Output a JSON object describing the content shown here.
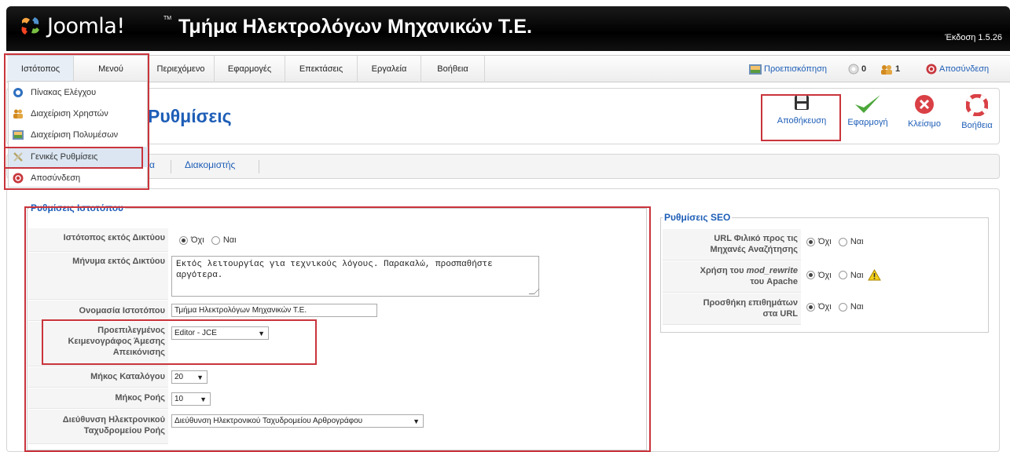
{
  "header": {
    "logo_text": "Joomla!",
    "logo_tm": "TM",
    "site_title": "Τμήμα Ηλεκτρολόγων Μηχανικών Τ.Ε.",
    "version": "Έκδοση 1.5.26"
  },
  "menubar": {
    "items": [
      {
        "label": "Ιστότοπος"
      },
      {
        "label": "Μενού"
      },
      {
        "label": "Περιεχόμενο"
      },
      {
        "label": "Εφαρμογές"
      },
      {
        "label": "Επεκτάσεις"
      },
      {
        "label": "Εργαλεία"
      },
      {
        "label": "Βοήθεια"
      }
    ],
    "preview": "Προεπισκόπηση",
    "messages_count": "0",
    "users_count": "1",
    "logout": "Αποσύνδεση"
  },
  "dropdown": {
    "items": [
      {
        "label": "Πίνακας Ελέγχου"
      },
      {
        "label": "Διαχείριση Χρηστών"
      },
      {
        "label": "Διαχείριση Πολυμέσων"
      },
      {
        "label": "Γενικές Ρυθμίσεις"
      },
      {
        "label": "Αποσύνδεση"
      }
    ]
  },
  "page": {
    "title": "Ρυθμίσεις"
  },
  "toolbar": {
    "save": "Αποθήκευση",
    "apply": "Εφαρμογή",
    "close": "Κλείσιμο",
    "help": "Βοήθεια"
  },
  "subtabs": {
    "partial": "α",
    "server": "Διακομιστής"
  },
  "site_settings": {
    "legend": "Ρυθμίσεις Ιστοτόπου",
    "offline_label": "Ιστότοπος εκτός Δικτύου",
    "no": "Όχι",
    "yes": "Ναι",
    "offline_msg_label": "Μήνυμα εκτός Δικτύου",
    "offline_msg_value": "Εκτός λειτουργίας για τεχνικούς λόγους. Παρακαλώ, προσπαθήστε αργότερα.",
    "site_name_label": "Ονομασία Ιστοτόπου",
    "site_name_value": "Τμήμα Ηλεκτρολόγων Μηχανικών Τ.Ε.",
    "editor_label_1": "Προεπιλεγμένος",
    "editor_label_2": "Κειμενογράφος Άμεσης",
    "editor_label_3": "Απεικόνισης",
    "editor_value": "Editor - JCE",
    "list_length_label": "Μήκος Καταλόγου",
    "list_length_value": "20",
    "feed_length_label": "Μήκος Ροής",
    "feed_length_value": "10",
    "feed_email_label_1": "Διεύθυνση Ηλεκτρονικού",
    "feed_email_label_2": "Ταχυδρομείου Ροής",
    "feed_email_value": "Διεύθυνση Ηλεκτρονικού Ταχυδρομείου Αρθρογράφου"
  },
  "seo_settings": {
    "legend": "Ρυθμίσεις SEO",
    "sef_label_1": "URL Φιλικό προς τις",
    "sef_label_2": "Μηχανές Αναζήτησης",
    "rewrite_label_1": "Χρήση του",
    "rewrite_label_em": "mod_rewrite",
    "rewrite_label_2": "του Apache",
    "suffix_label_1": "Προσθήκη επιθημάτων",
    "suffix_label_2": "στα URL",
    "no": "Όχι",
    "yes": "Ναι"
  }
}
